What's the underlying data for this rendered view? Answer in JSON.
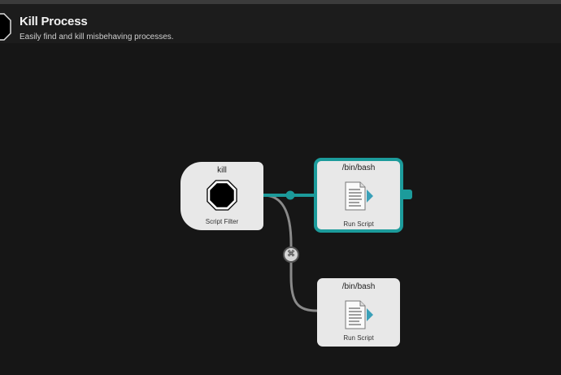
{
  "window": {
    "title": "Kill Process",
    "subtitle": "Easily find and kill misbehaving processes."
  },
  "header": {
    "icon": "stop-octagon-icon"
  },
  "nodes": [
    {
      "id": "script-filter",
      "title": "kill",
      "caption": "Script Filter",
      "icon": "stop-octagon-icon"
    },
    {
      "id": "run-script-1",
      "title": "/bin/bash",
      "caption": "Run Script",
      "icon": "script-document-icon",
      "selected": true
    },
    {
      "id": "run-script-2",
      "title": "/bin/bash",
      "caption": "Run Script",
      "icon": "script-document-icon"
    }
  ],
  "connections": [
    {
      "from": "script-filter",
      "to": "run-script-1",
      "highlighted": true
    },
    {
      "from": "script-filter",
      "to": "run-script-2",
      "modifier": "⌘"
    }
  ],
  "colors": {
    "background": "#161616",
    "accent": "#1c9b9b",
    "node": "#e8e8e8",
    "wire": "#8a8a8a"
  }
}
